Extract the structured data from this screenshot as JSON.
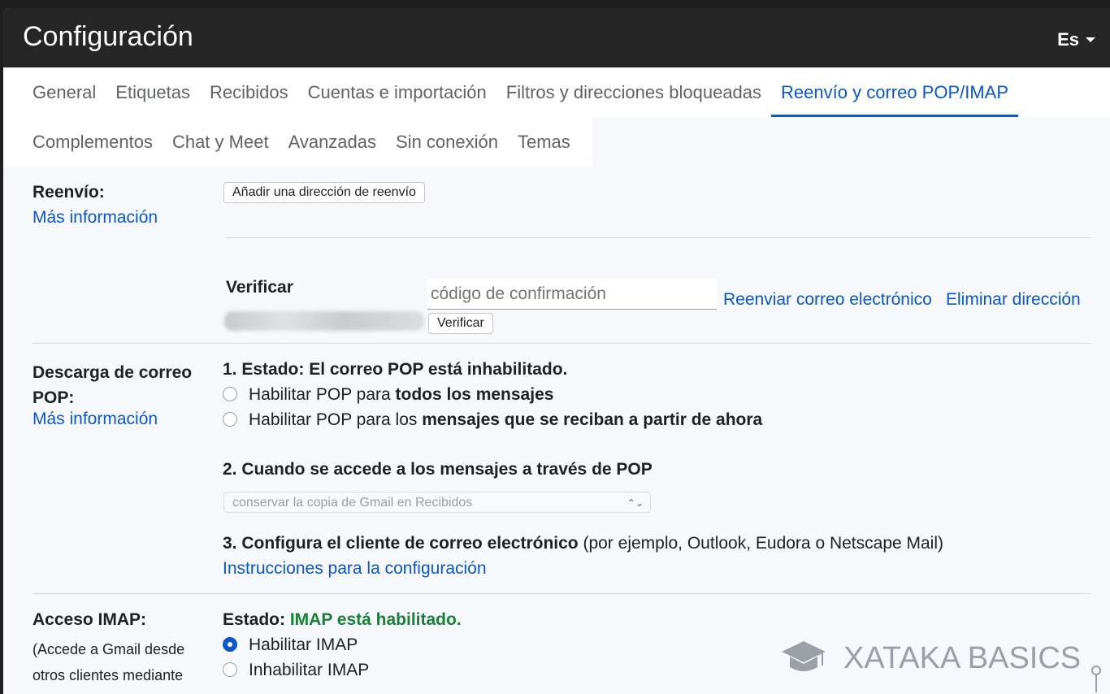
{
  "header": {
    "title": "Configuración",
    "language": "Es"
  },
  "tabs": {
    "row1": [
      "General",
      "Etiquetas",
      "Recibidos",
      "Cuentas e importación",
      "Filtros y direcciones bloqueadas",
      "Reenvío y correo POP/IMAP"
    ],
    "row2": [
      "Complementos",
      "Chat y Meet",
      "Avanzadas",
      "Sin conexión",
      "Temas"
    ],
    "active": "Reenvío y correo POP/IMAP"
  },
  "forwarding": {
    "label": "Reenvío:",
    "more_info": "Más información",
    "add_button": "Añadir una dirección de reenvío",
    "verify_label": "Verificar",
    "confirm_placeholder": "código de confirmación",
    "verify_button": "Verificar",
    "resend_link": "Reenviar correo electrónico",
    "remove_link": "Eliminar dirección"
  },
  "pop": {
    "label": "Descarga de correo POP:",
    "more_info": "Más información",
    "status_heading": "1. Estado: El correo POP está inhabilitado.",
    "option_all_prefix": "Habilitar POP para ",
    "option_all_bold": "todos los mensajes",
    "option_new_prefix": "Habilitar POP para los ",
    "option_new_bold": "mensajes que se reciban a partir de ahora",
    "access_heading": "2. Cuando se accede a los mensajes a través de POP",
    "access_select_value": "conservar la copia de Gmail en Recibidos",
    "client_heading_bold": "3. Configura el cliente de correo electrónico",
    "client_heading_rest": " (por ejemplo, Outlook, Eudora o Netscape Mail)",
    "instructions_link": "Instrucciones para la configuración"
  },
  "imap": {
    "label": "Acceso IMAP:",
    "sublabel": "(Accede a Gmail desde otros clientes mediante IMAP)",
    "status_prefix": "Estado: ",
    "status_value": "IMAP está habilitado.",
    "status_color": "#188038",
    "enable": "Habilitar IMAP",
    "disable": "Inhabilitar IMAP"
  },
  "watermark": {
    "text": "XATAKA BASICS",
    "icon": "graduation-cap-icon"
  },
  "colors": {
    "accent": "#0b57d0",
    "header_bg": "#262626"
  }
}
